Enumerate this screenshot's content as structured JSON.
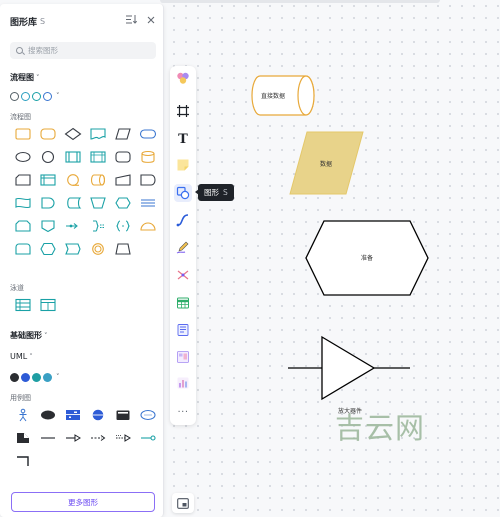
{
  "panel": {
    "title": "图形库",
    "badge": "S",
    "sort_icon": "sort-icon",
    "close_icon": "close-icon",
    "search": {
      "placeholder": "搜索图形",
      "icon": "search-icon"
    },
    "flowchart_section": {
      "title": "流程图",
      "caret": "˅"
    },
    "flowchart_swatches": [
      "#ffffff",
      "#ffffff",
      "#ffffff",
      "#ffffff"
    ],
    "flowchart_swatch_strokes": [
      "#546067",
      "#2b9fc0",
      "#1aa1a6",
      "#3a76d0"
    ],
    "flowchart_subtitle": "流程图",
    "lane_subtitle": "泳道",
    "basic_section": {
      "title": "基础图形",
      "caret": "˅"
    },
    "uml_section": {
      "title": "UML",
      "caret": "˅"
    },
    "uml_swatches": [
      "#2b2d31",
      "#2d5bd6",
      "#1f9ea3",
      "#3aa0c4"
    ],
    "usecase_subtitle": "用例图",
    "more_button": "更多图形"
  },
  "toolbar": {
    "tools": [
      "theme-icon",
      "frame-icon",
      "text-icon",
      "sticky-note-icon",
      "shape-icon",
      "connector-icon",
      "pen-icon",
      "mindmap-icon",
      "table-icon",
      "template-icon",
      "kanban-icon",
      "chart-icon",
      "more-icon"
    ],
    "more_label": "···",
    "text_label": "T",
    "tooltip": {
      "label": "图形",
      "shortcut": "S"
    },
    "bottom_tool": "minimap-icon"
  },
  "canvas": {
    "shapes": [
      {
        "name": "direct-data-shape",
        "label": "直接数据",
        "fill": "#ffffff",
        "stroke": "#e8a93a"
      },
      {
        "name": "data-shape",
        "label": "数据",
        "fill": "#e8d38a",
        "stroke": "#e4c86a"
      },
      {
        "name": "preparation-shape",
        "label": "准备",
        "fill": "#ffffff",
        "stroke": "#000000"
      },
      {
        "name": "amplifier-shape",
        "label": "放大器",
        "fill": "#ffffff",
        "stroke": "#000000"
      }
    ],
    "amplifier_caption": "放大器件"
  },
  "watermark": "吉云网",
  "colors": {
    "accent": "#6a48f2",
    "flow_stroke": "#e8a93a",
    "teal": "#1aa1a6",
    "blue": "#3a76d0"
  }
}
